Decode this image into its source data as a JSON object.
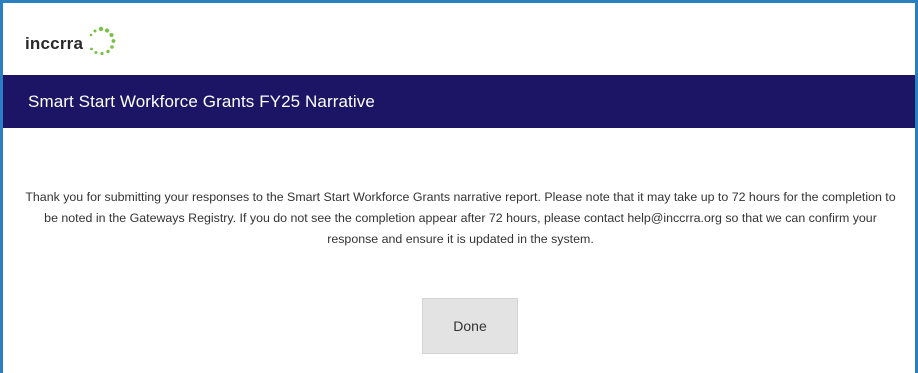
{
  "logo": {
    "text": "inccrra",
    "icon": "dotted-circle-logo-icon",
    "dot_color": "#7ac143"
  },
  "header": {
    "title": "Smart Start Workforce Grants FY25 Narrative",
    "background": "#1c1464"
  },
  "main": {
    "message": "Thank you for submitting your responses to the Smart Start Workforce Grants narrative report. Please note that it may take up to 72 hours for the completion to be noted in the Gateways Registry. If you do not see the completion appear after 72 hours, please contact help@inccrra.org so that we can confirm your response and ensure it is updated in the system.",
    "done_label": "Done"
  },
  "frame_border_color": "#2a7fc0"
}
